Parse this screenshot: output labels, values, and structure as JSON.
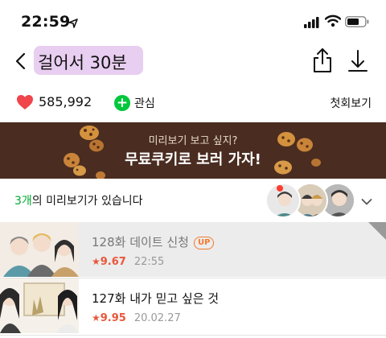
{
  "status_bar": {
    "time": "22:59",
    "icons": [
      "location-arrow-icon",
      "cellular-signal-icon",
      "wifi-icon",
      "battery-icon"
    ]
  },
  "nav": {
    "title": "걸어서 30분",
    "icons": [
      "back-chevron-icon",
      "share-icon",
      "download-icon"
    ]
  },
  "info": {
    "like_count": "585,992",
    "interest_label": "관심",
    "first_episode_label": "첫회보기",
    "heart_color": "#f0454b",
    "interest_color": "#00c73c"
  },
  "banner": {
    "sub_text": "미리보기 보고 싶지?",
    "main_text": "무료쿠키로 보러 가자!",
    "background": "#4a2c20"
  },
  "preview": {
    "count": "3개",
    "text": "의 미리보기가 있습니다"
  },
  "episodes": [
    {
      "title": "128화 데이트 신청",
      "badge": "UP",
      "rating": "9.67",
      "date": "22:55"
    },
    {
      "title": "127화 내가 믿고 싶은 것",
      "badge": "",
      "rating": "9.95",
      "date": "20.02.27"
    }
  ],
  "colors": {
    "accent_green": "#00a832",
    "rating_red": "#e8573a",
    "up_orange": "#f07b2d"
  }
}
